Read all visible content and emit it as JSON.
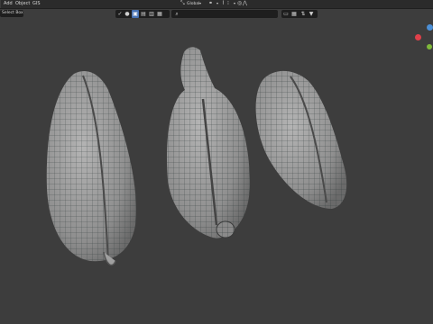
{
  "menu": [
    {
      "id": "add",
      "label": "Add"
    },
    {
      "id": "object",
      "label": "Object"
    },
    {
      "id": "gis",
      "label": "GIS"
    }
  ],
  "header": {
    "orientation_label": "Global",
    "select_mode": "Select Box"
  },
  "gizmo": {
    "x_color": "#e0404a",
    "y_color": "#7fb93a",
    "z_color": "#4b8fd6"
  },
  "viewport": {
    "background_color": "#3d3d3d",
    "mesh_color": "#9b9b9b",
    "wire_color": "#2f3a3a"
  }
}
